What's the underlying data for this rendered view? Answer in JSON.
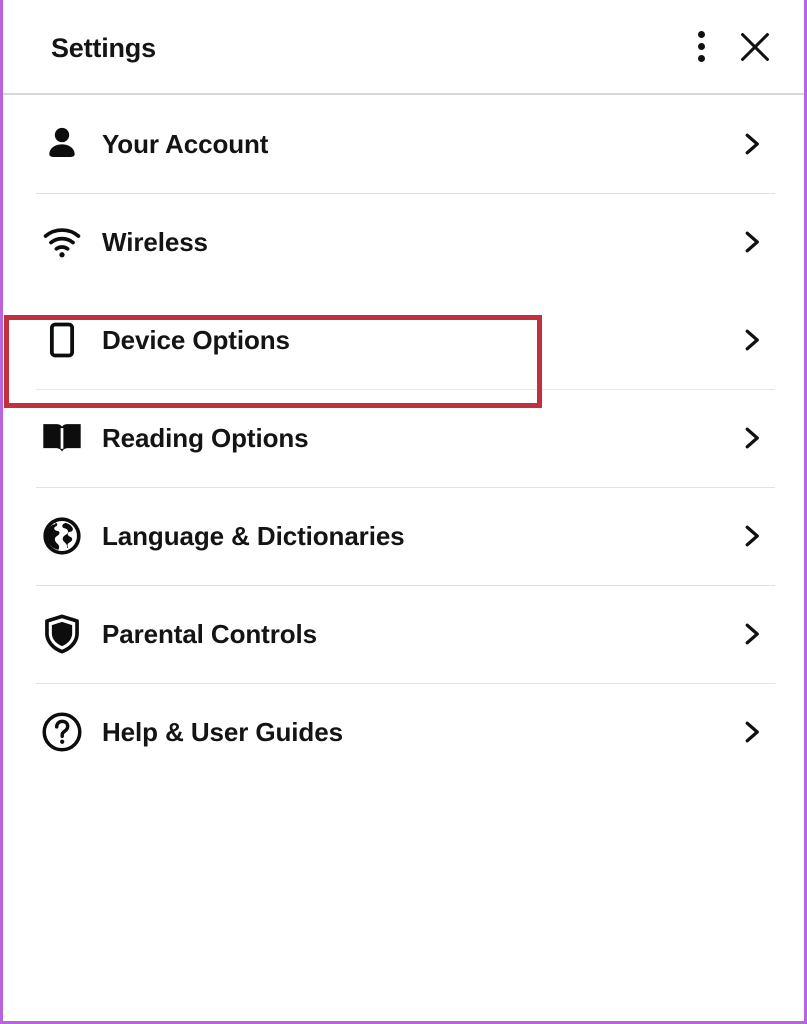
{
  "window": {
    "frame_color": "#b964dd",
    "background": "#ffffff"
  },
  "header": {
    "title": "Settings",
    "overflow_menu": {
      "name": "more-options",
      "icon": "kebab-menu-icon",
      "label": "More options"
    },
    "close": {
      "name": "close",
      "icon": "close-icon",
      "label": "Close"
    }
  },
  "annotation": {
    "type": "highlight-rectangle",
    "color": "#c23040",
    "targets": "Device Options"
  },
  "settings": {
    "items": [
      {
        "id": "your-account",
        "label": "Your Account",
        "icon": "person-icon",
        "chevron": "chevron-right-icon",
        "highlighted": false
      },
      {
        "id": "wireless",
        "label": "Wireless",
        "icon": "wifi-icon",
        "chevron": "chevron-right-icon",
        "highlighted": false
      },
      {
        "id": "device-options",
        "label": "Device Options",
        "icon": "device-icon",
        "chevron": "chevron-right-icon",
        "highlighted": true
      },
      {
        "id": "reading-options",
        "label": "Reading Options",
        "icon": "open-book-icon",
        "chevron": "chevron-right-icon",
        "highlighted": false
      },
      {
        "id": "language-dictionaries",
        "label": "Language & Dictionaries",
        "icon": "globe-icon",
        "chevron": "chevron-right-icon",
        "highlighted": false
      },
      {
        "id": "parental-controls",
        "label": "Parental Controls",
        "icon": "shield-icon",
        "chevron": "chevron-right-icon",
        "highlighted": false
      },
      {
        "id": "help-user-guides",
        "label": "Help & User Guides",
        "icon": "question-mark-icon",
        "chevron": "chevron-right-icon",
        "highlighted": false
      }
    ]
  }
}
